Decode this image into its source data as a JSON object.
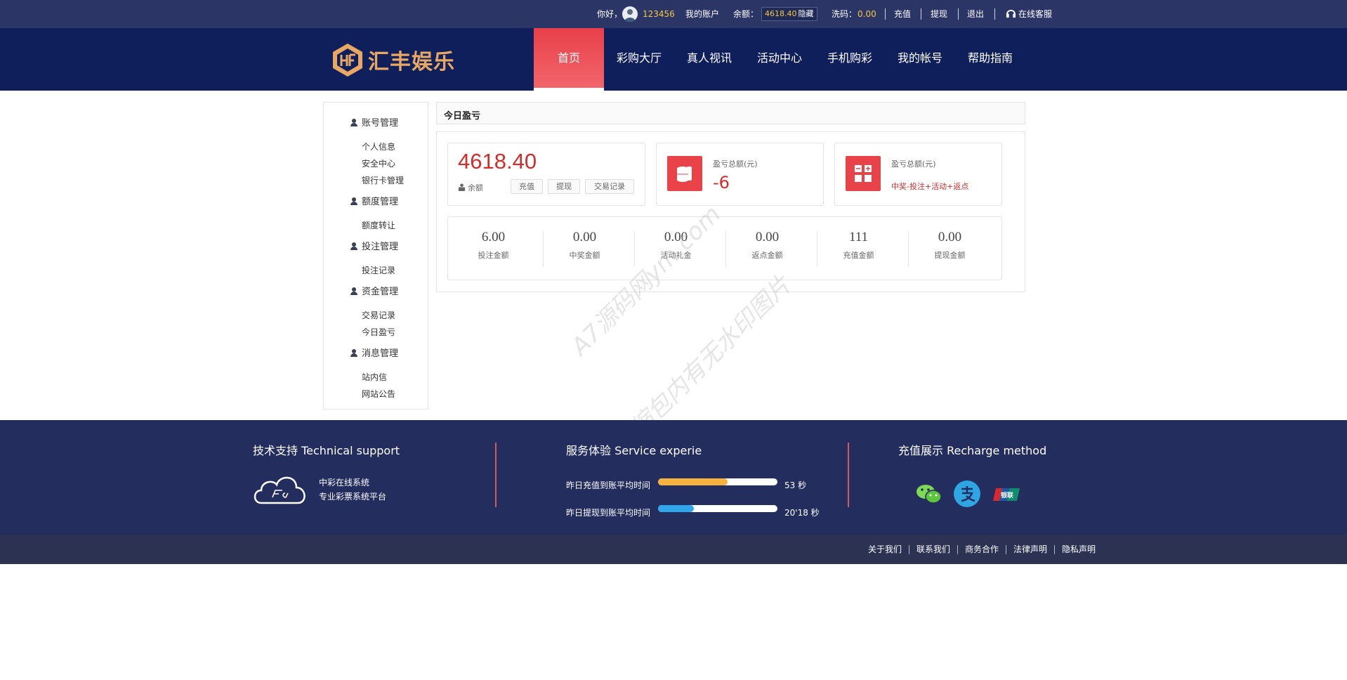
{
  "topbar": {
    "greeting": "你好，",
    "username": "123456",
    "my_account": "我的账户",
    "balance_label": "余额：",
    "balance_value": "4618.40",
    "hide_label": "隐藏",
    "wash_label": "洗码：",
    "wash_value": "0.00",
    "recharge": "充值",
    "withdraw": "提现",
    "logout": "退出",
    "support": "在线客服"
  },
  "brand": {
    "logo_text": "汇丰娱乐",
    "logo_color": "#e8a863"
  },
  "nav": {
    "items": [
      "首页",
      "彩购大厅",
      "真人视讯",
      "活动中心",
      "手机购彩",
      "我的帐号",
      "帮助指南"
    ],
    "active_index": 0
  },
  "sidebar": {
    "groups": [
      {
        "title": "账号管理",
        "links": [
          "个人信息",
          "安全中心",
          "银行卡管理"
        ]
      },
      {
        "title": "额度管理",
        "links": [
          "额度转让"
        ]
      },
      {
        "title": "投注管理",
        "links": [
          "投注记录"
        ]
      },
      {
        "title": "资金管理",
        "links": [
          "交易记录",
          "今日盈亏"
        ]
      },
      {
        "title": "消息管理",
        "links": [
          "站内信",
          "网站公告"
        ]
      }
    ]
  },
  "panel": {
    "title": "今日盈亏",
    "balance_card": {
      "amount": "4618.40",
      "label": "余额",
      "buttons": [
        "充值",
        "提现",
        "交易记录"
      ]
    },
    "profit_card": {
      "label": "盈亏总额(元)",
      "value": "-6"
    },
    "formula_card": {
      "label": "盈亏总额(元)",
      "formula": "中奖-投注+活动+返点"
    },
    "stats": [
      {
        "value": "6.00",
        "label": "投注金额"
      },
      {
        "value": "0.00",
        "label": "中奖金额"
      },
      {
        "value": "0.00",
        "label": "活动礼金"
      },
      {
        "value": "0.00",
        "label": "返点金额"
      },
      {
        "value": "111",
        "label": "充值金额"
      },
      {
        "value": "0.00",
        "label": "提现金额"
      }
    ]
  },
  "watermark": {
    "line1": "A7源码网ym.com",
    "line2": "压缩包内有无水印图片"
  },
  "footer": {
    "support_title": "技术支持 Technical support",
    "support_line1": "中彩在线系统",
    "support_line2": "专业彩票系统平台",
    "service_title": "服务体验 Service experie",
    "recharge_label": "昨日充值到账平均时间",
    "recharge_time": "53 秒",
    "recharge_fill_percent": 58,
    "withdraw_label": "昨日提现到账平均时间",
    "withdraw_time": "20'18 秒",
    "withdraw_fill_percent": 30,
    "recharge_method_title": "充值展示 Recharge method",
    "methods": [
      "wechat-icon",
      "alipay-icon",
      "unionpay-icon"
    ],
    "unionpay_text": "银联"
  },
  "bottom_links": [
    "关于我们",
    "联系我们",
    "商务合作",
    "法律声明",
    "隐私声明"
  ]
}
